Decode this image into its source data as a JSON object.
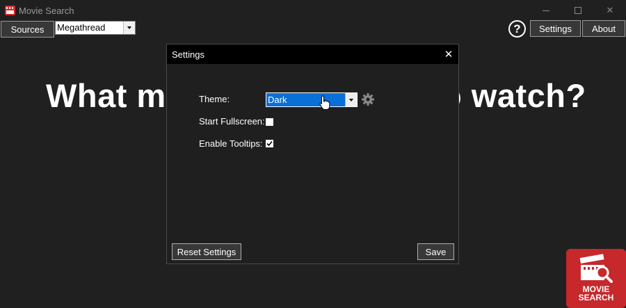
{
  "window": {
    "title": "Movie Search",
    "controls": {
      "minimize": "",
      "maximize": "",
      "close": "✕"
    }
  },
  "toolbar": {
    "sources_label": "Sources",
    "source_select_value": "Megathread",
    "help_glyph": "?",
    "settings_label": "Settings",
    "about_label": "About"
  },
  "main": {
    "headline_left": "What m",
    "headline_right": "o watch?"
  },
  "dialog": {
    "title": "Settings",
    "close_glyph": "✕",
    "theme_label": "Theme:",
    "theme_value": "Dark",
    "fullscreen_label": "Start Fullscreen:",
    "fullscreen_checked": false,
    "tooltips_label": "Enable Tooltips:",
    "tooltips_checked": true,
    "reset_label": "Reset Settings",
    "save_label": "Save"
  },
  "logo": {
    "line1": "MOVIE",
    "line2": "SEARCH"
  },
  "colors": {
    "background": "#202020",
    "dialog_header": "#000000",
    "select_highlight": "#0a6fd6",
    "logo_red": "#c7282b"
  },
  "icons": [
    "app-icon",
    "chevron-down-icon",
    "help-icon",
    "gear-icon",
    "close-icon",
    "checkmark-icon",
    "hand-cursor-icon"
  ]
}
